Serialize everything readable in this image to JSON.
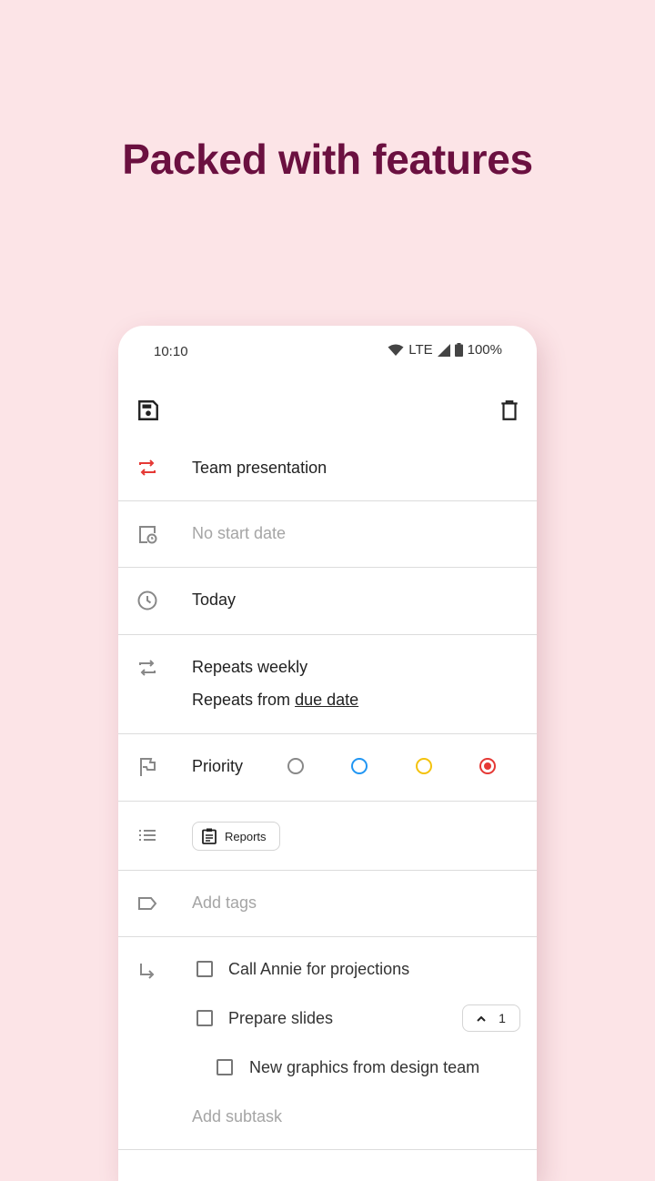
{
  "headline": "Packed with features",
  "status_bar": {
    "time": "10:10",
    "network": "LTE",
    "battery": "100%"
  },
  "toolbar": {
    "save_icon": "save-icon",
    "delete_icon": "delete-icon"
  },
  "task": {
    "title": "Team presentation"
  },
  "start_date": {
    "placeholder": "No start date"
  },
  "due_date": {
    "value": "Today"
  },
  "repeat": {
    "line1": "Repeats weekly",
    "line2_prefix": "Repeats from",
    "line2_link": "due date"
  },
  "priority": {
    "label": "Priority",
    "options": [
      "#888888",
      "#2196f3",
      "#f4c20d",
      "#e53935"
    ],
    "selected": 3
  },
  "list": {
    "chip_label": "Reports"
  },
  "tags": {
    "placeholder": "Add tags"
  },
  "subtasks": {
    "items": [
      {
        "label": "Call Annie for projections"
      },
      {
        "label": "Prepare slides",
        "count": "1"
      },
      {
        "label": "New graphics from design team"
      }
    ],
    "add_placeholder": "Add subtask"
  },
  "colors": {
    "accent": "#e53935",
    "headline": "#6b1040",
    "background": "#fce4e7"
  }
}
